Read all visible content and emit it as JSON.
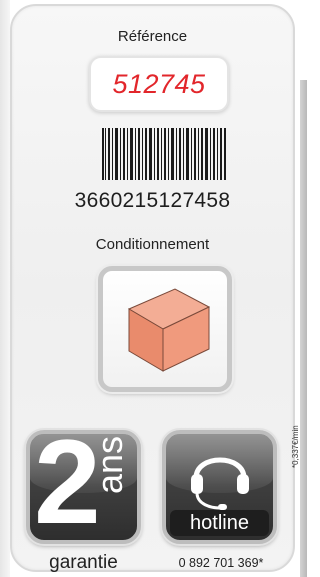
{
  "reference": {
    "label": "Référence",
    "value": "512745"
  },
  "barcode": {
    "number": "3660215127458"
  },
  "packaging": {
    "label": "Conditionnement",
    "icon": "brick-box-icon"
  },
  "warranty": {
    "number": "2",
    "unit": "ans",
    "caption": "garantie"
  },
  "hotline": {
    "badge": "hotline",
    "phone": "0 892 701 369*",
    "rate_note": "*0,337€/min",
    "icon": "headset-icon"
  },
  "colors": {
    "reference_value": "#e2262b",
    "tile_dark": "#3f3f3f",
    "box_fill": "#ec9478"
  }
}
